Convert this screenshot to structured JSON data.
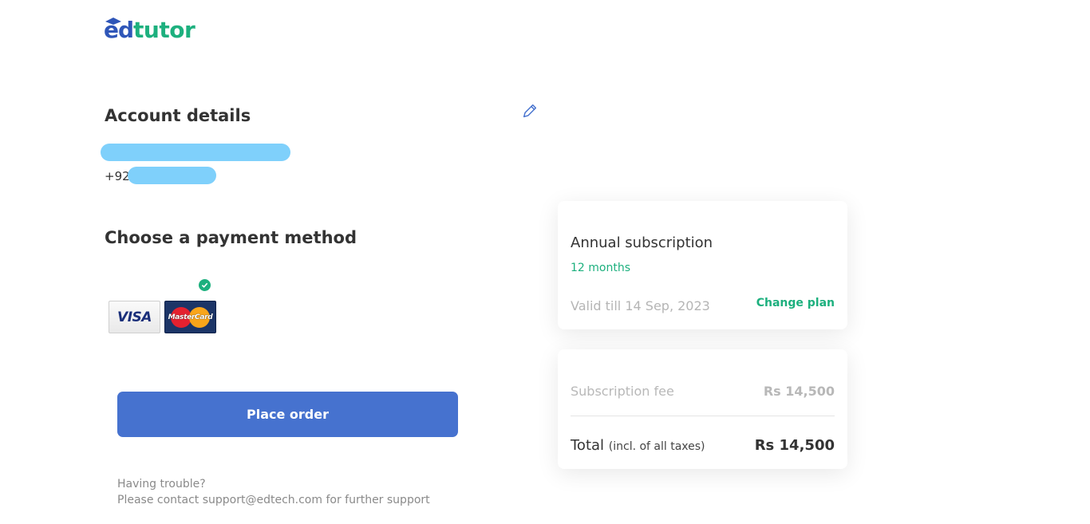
{
  "brand": {
    "logo_part1": "ed",
    "logo_part2": "tutor",
    "color_primary": "#2f56b8",
    "color_accent": "#1db07e"
  },
  "account": {
    "title": "Account details",
    "phone_prefix": "+92",
    "edit_icon": "pencil-icon"
  },
  "payment": {
    "title": "Choose a payment method",
    "methods": [
      {
        "label": "VISA",
        "icon": "visa-card-icon"
      },
      {
        "label": "MasterCard",
        "icon": "mastercard-icon",
        "selected": true
      }
    ]
  },
  "place_order_label": "Place order",
  "support": {
    "line1": "Having trouble?",
    "line2": "Please contact support@edtech.com for further support"
  },
  "plan": {
    "name": "Annual subscription",
    "duration": "12 months",
    "valid_till": "Valid till 14 Sep, 2023",
    "change_label": "Change plan"
  },
  "summary": {
    "fee_label": "Subscription fee",
    "fee_value": "Rs 14,500",
    "total_label": "Total",
    "total_note": "(incl. of all taxes)",
    "total_value": "Rs 14,500"
  },
  "colors": {
    "button": "#4672cf",
    "success": "#1db07e",
    "redaction": "#7fd0fb"
  }
}
